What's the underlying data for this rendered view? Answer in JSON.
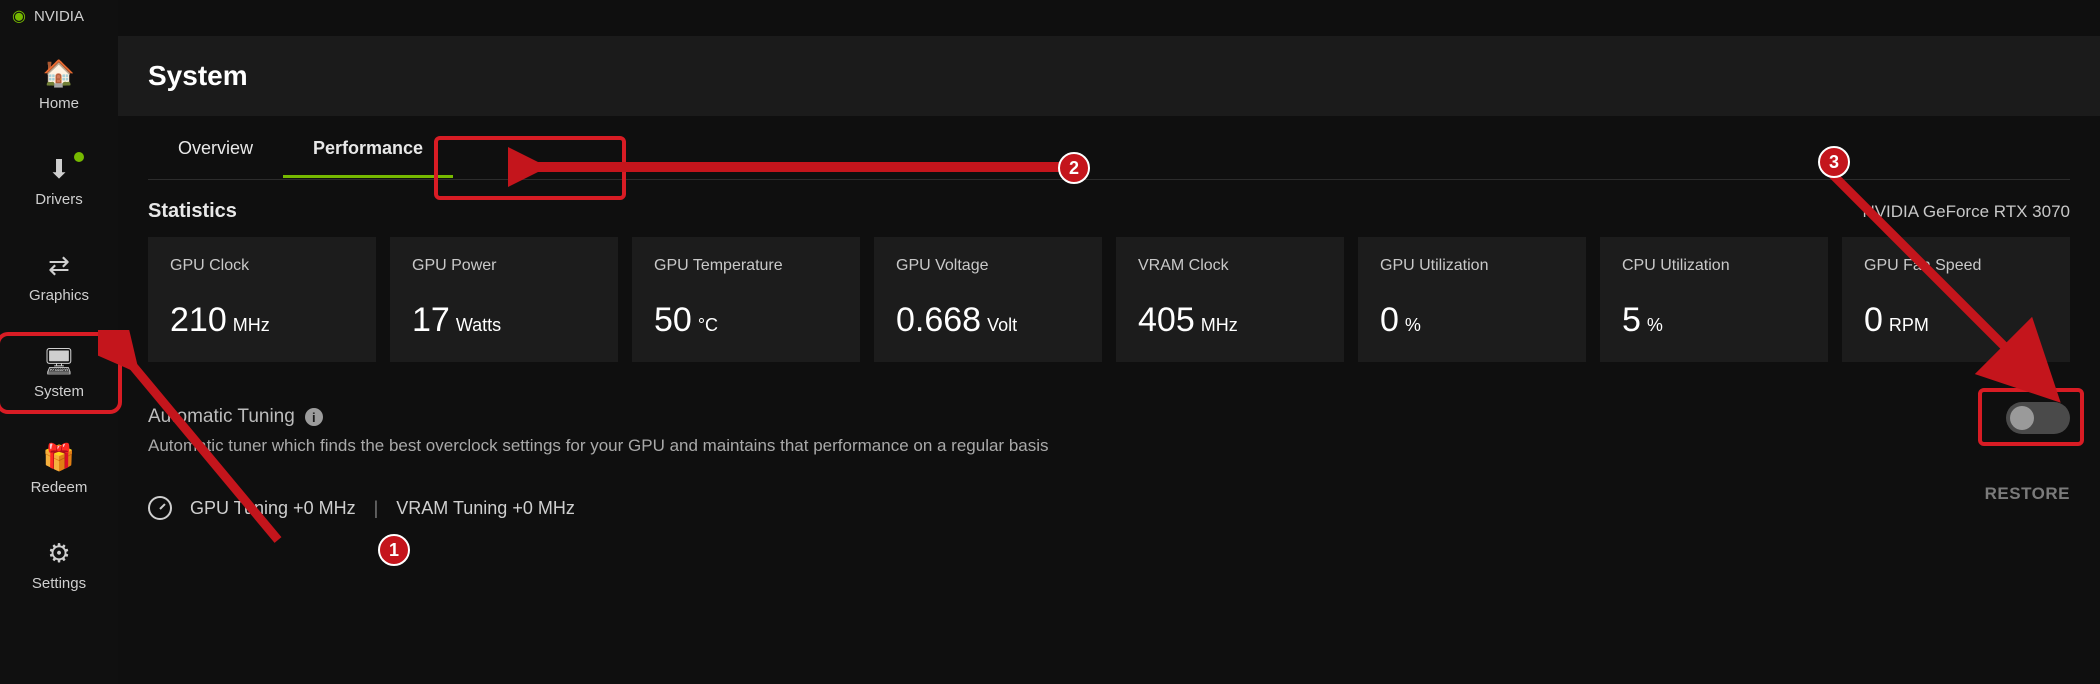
{
  "brand": "NVIDIA",
  "sidebar": {
    "items": [
      {
        "label": "Home",
        "icon": "🏠"
      },
      {
        "label": "Drivers",
        "icon": "⬇"
      },
      {
        "label": "Graphics",
        "icon": "⇄"
      },
      {
        "label": "System",
        "icon": "🖥"
      },
      {
        "label": "Redeem",
        "icon": "🎁"
      },
      {
        "label": "Settings",
        "icon": "⚙"
      }
    ]
  },
  "page": {
    "title": "System"
  },
  "tabs": {
    "overview": "Overview",
    "performance": "Performance"
  },
  "stats": {
    "section_title": "Statistics",
    "gpu_name": "NVIDIA GeForce RTX 3070",
    "cards": [
      {
        "label": "GPU Clock",
        "value": "210",
        "unit": "MHz"
      },
      {
        "label": "GPU Power",
        "value": "17",
        "unit": "Watts"
      },
      {
        "label": "GPU Temperature",
        "value": "50",
        "unit": "°C"
      },
      {
        "label": "GPU Voltage",
        "value": "0.668",
        "unit": "Volt"
      },
      {
        "label": "VRAM Clock",
        "value": "405",
        "unit": "MHz"
      },
      {
        "label": "GPU Utilization",
        "value": "0",
        "unit": "%"
      },
      {
        "label": "CPU Utilization",
        "value": "5",
        "unit": "%"
      },
      {
        "label": "GPU Fan Speed",
        "value": "0",
        "unit": "RPM"
      }
    ]
  },
  "tuning": {
    "title": "Automatic Tuning",
    "desc": "Automatic tuner which finds the best overclock settings for your GPU and maintains that performance on a regular basis",
    "gpu_text": "GPU Tuning +0 MHz",
    "vram_text": "VRAM Tuning +0 MHz",
    "restore": "RESTORE"
  },
  "annotations": {
    "b1": "1",
    "b2": "2",
    "b3": "3"
  }
}
